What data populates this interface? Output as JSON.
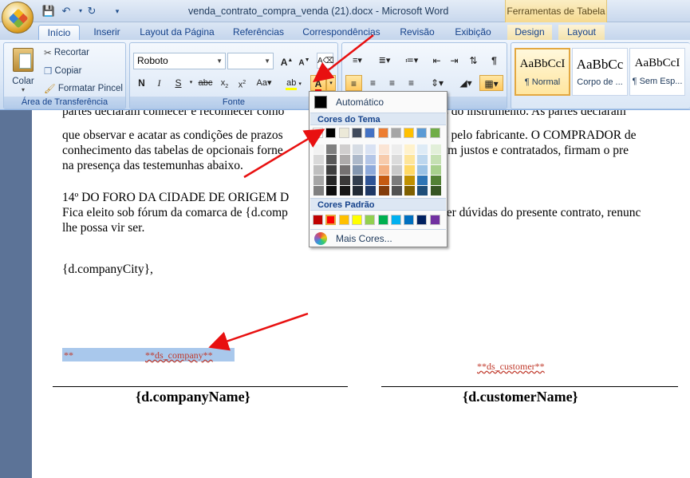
{
  "window": {
    "title": "venda_contrato_compra_venda (21).docx - Microsoft Word",
    "contextual_tab_header": "Ferramentas de Tabela"
  },
  "tabs": [
    "Início",
    "Inserir",
    "Layout da Página",
    "Referências",
    "Correspondências",
    "Revisão",
    "Exibição",
    "Design",
    "Layout"
  ],
  "ribbon": {
    "clipboard": {
      "paste_label": "Colar",
      "cut_label": "Recortar",
      "copy_label": "Copiar",
      "format_painter_label": "Formatar Pincel",
      "group_label": "Área de Transferência"
    },
    "font": {
      "font_name": "Roboto",
      "font_size": "",
      "group_label": "Fonte"
    },
    "styles": [
      {
        "preview": "AaBbCcI",
        "name": "¶ Normal"
      },
      {
        "preview": "AaBbCc",
        "name": "Corpo de ..."
      },
      {
        "preview": "AaBbCcI",
        "name": "¶ Sem Esp..."
      }
    ]
  },
  "color_picker": {
    "automatic_label": "Automático",
    "theme_colors_label": "Cores do Tema",
    "standard_colors_label": "Cores Padrão",
    "more_colors_label": "Mais Cores...",
    "theme_top": [
      "#ffffff",
      "#000000",
      "#eeece1",
      "#1f497d",
      "#4f81bd",
      "#c0504d",
      "#9bbb59",
      "#8064a2",
      "#4bacc6",
      "#f79646"
    ],
    "theme_top_display": [
      "#ffffff",
      "#000000",
      "#ece9d8",
      "#404a5c",
      "#4472c4",
      "#ed7d31",
      "#a5a5a5",
      "#ffc000",
      "#5b9bd5",
      "#70ad47"
    ],
    "shade_columns": [
      [
        "#f2f2f2",
        "#d9d9d9",
        "#bfbfbf",
        "#a6a6a6",
        "#808080"
      ],
      [
        "#7f7f7f",
        "#595959",
        "#3f3f3f",
        "#262626",
        "#0d0d0d"
      ],
      [
        "#d0cece",
        "#aeabab",
        "#757171",
        "#3a3838",
        "#171616"
      ],
      [
        "#d6dce4",
        "#adb9ca",
        "#8497b0",
        "#333f4f",
        "#222a35"
      ],
      [
        "#d9e2f3",
        "#b4c6e7",
        "#8eaadb",
        "#2f5496",
        "#1f3864"
      ],
      [
        "#fbe5d5",
        "#f7cbac",
        "#f4b183",
        "#c55a11",
        "#833c0b"
      ],
      [
        "#ededed",
        "#dbdbdb",
        "#c9c9c9",
        "#7b7b7b",
        "#525252"
      ],
      [
        "#fff2cc",
        "#fee599",
        "#ffd965",
        "#bf9000",
        "#7f6000"
      ],
      [
        "#deebf6",
        "#bdd7ee",
        "#9cc3e5",
        "#2e75b5",
        "#1e4e79"
      ],
      [
        "#e2efd9",
        "#c5e0b3",
        "#a8d08d",
        "#538135",
        "#375623"
      ]
    ],
    "standard": [
      "#c00000",
      "#ff0000",
      "#ffc000",
      "#ffff00",
      "#92d050",
      "#00b050",
      "#00b0f0",
      "#0070c0",
      "#002060",
      "#7030a0"
    ]
  },
  "document": {
    "lines": [
      "partes declaram conhecer e reconhecer como",
      "que observar e acatar as condições de prazos",
      "conhecimento das tabelas de opcionais forne",
      "na presença das testemunhas abaixo."
    ],
    "line_right_parts": [
      "os dados do instrumento. As partes declaram",
      "gerídos pelo fabricante. O COMPRADOR  de",
      "r estarem justos e contratados, firmam o pre",
      ""
    ],
    "clause_title": "14º DO FORO DA CIDADE DE ORIGEM D",
    "clause_line1_left": "Fica eleito sob fórum da comarca de {d.comp",
    "clause_line1_right": "aisquer dúvidas do presente contrato, renunc",
    "clause_line2": "lhe possa vir ser.",
    "city_placeholder": "{d.companyCity},",
    "company_marker_left": "**",
    "company_marker_right": "**ds_company**",
    "customer_marker": "**ds_customer**",
    "company_name": "{d.companyName}",
    "customer_name": "{d.customerName}"
  },
  "colors": {
    "annotation_arrow": "#e81010",
    "highlight_selection": "#a9c8ec",
    "font_color_bar": "#e00000"
  }
}
